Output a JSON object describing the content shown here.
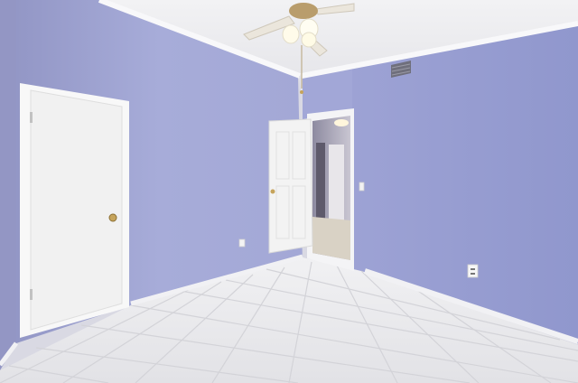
{
  "scene": {
    "description_label": "",
    "colors": {
      "wall_left": "#a9aed9",
      "wall_left_far": "#9ea2cf",
      "wall_back": "#a3a7d8",
      "wall_right": "#9aa0d2",
      "ceiling": "#efeff2",
      "crown_molding": "#f6f6f8",
      "floor_tile": "#e9e9ec",
      "grout": "#d2d2d6",
      "door": "#f3f3f3",
      "door_trim": "#f7f7f7",
      "baseboard": "#efeff1",
      "hallway_wall": "#b8b6c4",
      "hallway_floor": "#d6cfc2",
      "fan_blade": "#ece8e0",
      "fan_metal": "#b89a6a",
      "vent": "#7a7a86"
    },
    "icons": [
      "ceiling-fan-icon",
      "door-knob-icon",
      "air-vent-icon",
      "power-outlet-icon",
      "light-switch-icon"
    ]
  }
}
